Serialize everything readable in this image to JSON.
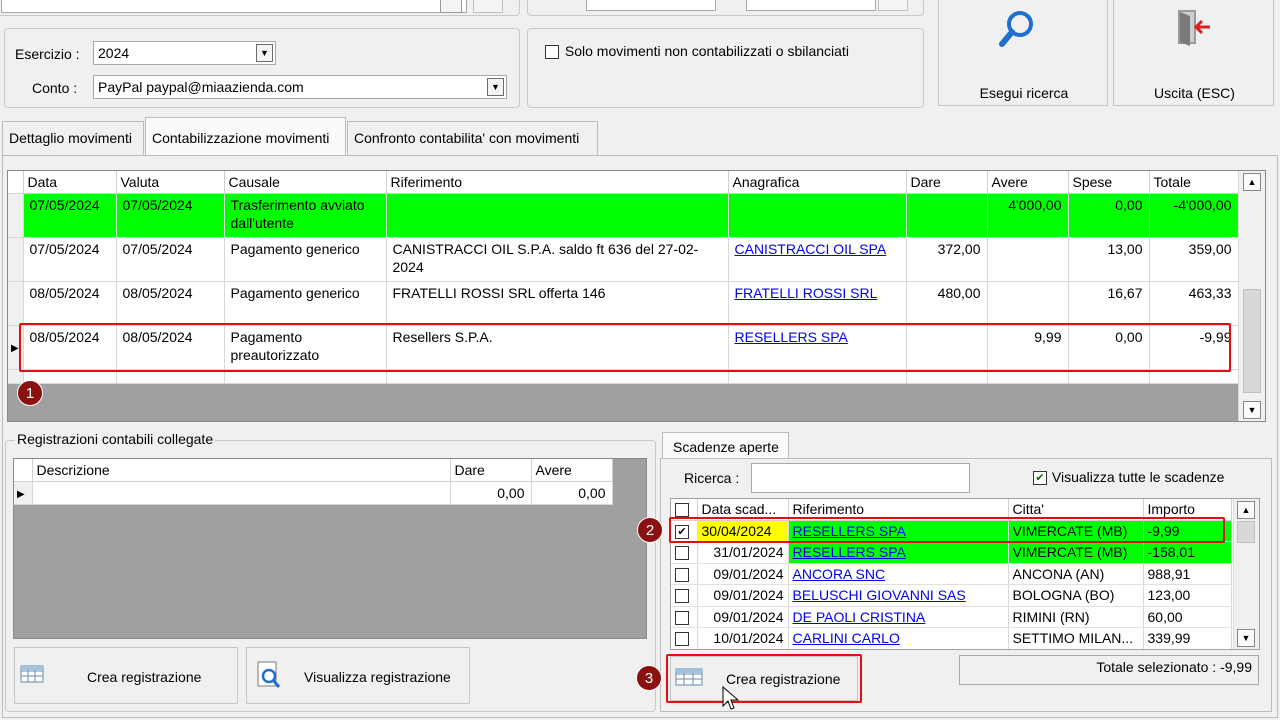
{
  "filters": {
    "esercizio_label": "Esercizio :",
    "esercizio_value": "2024",
    "conto_label": "Conto :",
    "conto_value": "PayPal paypal@miaazienda.com",
    "solo_movimenti_label": "Solo movimenti non contabilizzati o sbilanciati"
  },
  "actions": {
    "search_label": "Esegui ricerca",
    "exit_label": "Uscita (ESC)"
  },
  "tabs": [
    {
      "label": "Dettaglio movimenti"
    },
    {
      "label": "Contabilizzazione movimenti"
    },
    {
      "label": "Confronto contabilita' con movimenti"
    }
  ],
  "movements": {
    "columns": [
      "Data",
      "Valuta",
      "Causale",
      "Riferimento",
      "Anagrafica",
      "Dare",
      "Avere",
      "Spese",
      "Totale"
    ],
    "rows": [
      {
        "data": "07/05/2024",
        "valuta": "07/05/2024",
        "causale": "Trasferimento avviato dall'utente",
        "riferimento": "",
        "anagrafica": "",
        "dare": "",
        "avere": "4'000,00",
        "spese": "0,00",
        "totale": "-4'000,00"
      },
      {
        "data": "07/05/2024",
        "valuta": "07/05/2024",
        "causale": "Pagamento generico",
        "riferimento": "CANISTRACCI OIL S.P.A. saldo ft 636 del 27-02-2024",
        "anagrafica": "CANISTRACCI OIL SPA",
        "dare": "372,00",
        "avere": "",
        "spese": "13,00",
        "totale": "359,00"
      },
      {
        "data": "08/05/2024",
        "valuta": "08/05/2024",
        "causale": "Pagamento generico",
        "riferimento": "FRATELLI ROSSI SRL offerta 146",
        "anagrafica": "FRATELLI ROSSI SRL",
        "dare": "480,00",
        "avere": "",
        "spese": "16,67",
        "totale": "463,33"
      },
      {
        "data": "08/05/2024",
        "valuta": "08/05/2024",
        "causale": "Pagamento preautorizzato",
        "riferimento": "Resellers S.P.A.",
        "anagrafica": "RESELLERS SPA",
        "dare": "",
        "avere": "9,99",
        "spese": "0,00",
        "totale": "-9,99"
      }
    ]
  },
  "registrazioni": {
    "title": "Registrazioni contabili collegate",
    "columns": [
      "Descrizione",
      "Dare",
      "Avere"
    ],
    "row": {
      "descrizione": "",
      "dare": "0,00",
      "avere": "0,00"
    },
    "crea_label": "Crea registrazione",
    "visualizza_label": "Visualizza registrazione"
  },
  "scadenze": {
    "tab_label": "Scadenze aperte",
    "ricerca_label": "Ricerca :",
    "ricerca_value": "",
    "visualizza_tutte_label": "Visualizza tutte le scadenze",
    "columns": [
      "Data scad...",
      "Riferimento",
      "Citta'",
      "Importo"
    ],
    "rows": [
      {
        "data": "30/04/2024",
        "riferimento": "RESELLERS SPA",
        "citta": "VIMERCATE (MB)",
        "importo": "-9,99"
      },
      {
        "data": "31/01/2024",
        "riferimento": "RESELLERS SPA",
        "citta": "VIMERCATE (MB)",
        "importo": "-158,01"
      },
      {
        "data": "09/01/2024",
        "riferimento": "ANCORA SNC",
        "citta": "ANCONA (AN)",
        "importo": "988,91"
      },
      {
        "data": "09/01/2024",
        "riferimento": "BELUSCHI GIOVANNI SAS",
        "citta": "BOLOGNA (BO)",
        "importo": "123,00"
      },
      {
        "data": "09/01/2024",
        "riferimento": "DE PAOLI CRISTINA",
        "citta": "RIMINI (RN)",
        "importo": "60,00"
      },
      {
        "data": "10/01/2024",
        "riferimento": "CARLINI CARLO",
        "citta": "SETTIMO MILAN...",
        "importo": "339,99"
      }
    ],
    "crea_label": "Crea registrazione",
    "totale_label": "Totale selezionato : -9,99"
  },
  "callouts": [
    "1",
    "2",
    "3"
  ],
  "colors": {
    "highlight_green": "#00ff00",
    "highlight_yellow": "#ffff00",
    "callout_red": "#8b1010",
    "box_red": "#e01010",
    "link_blue": "#0000ee"
  }
}
